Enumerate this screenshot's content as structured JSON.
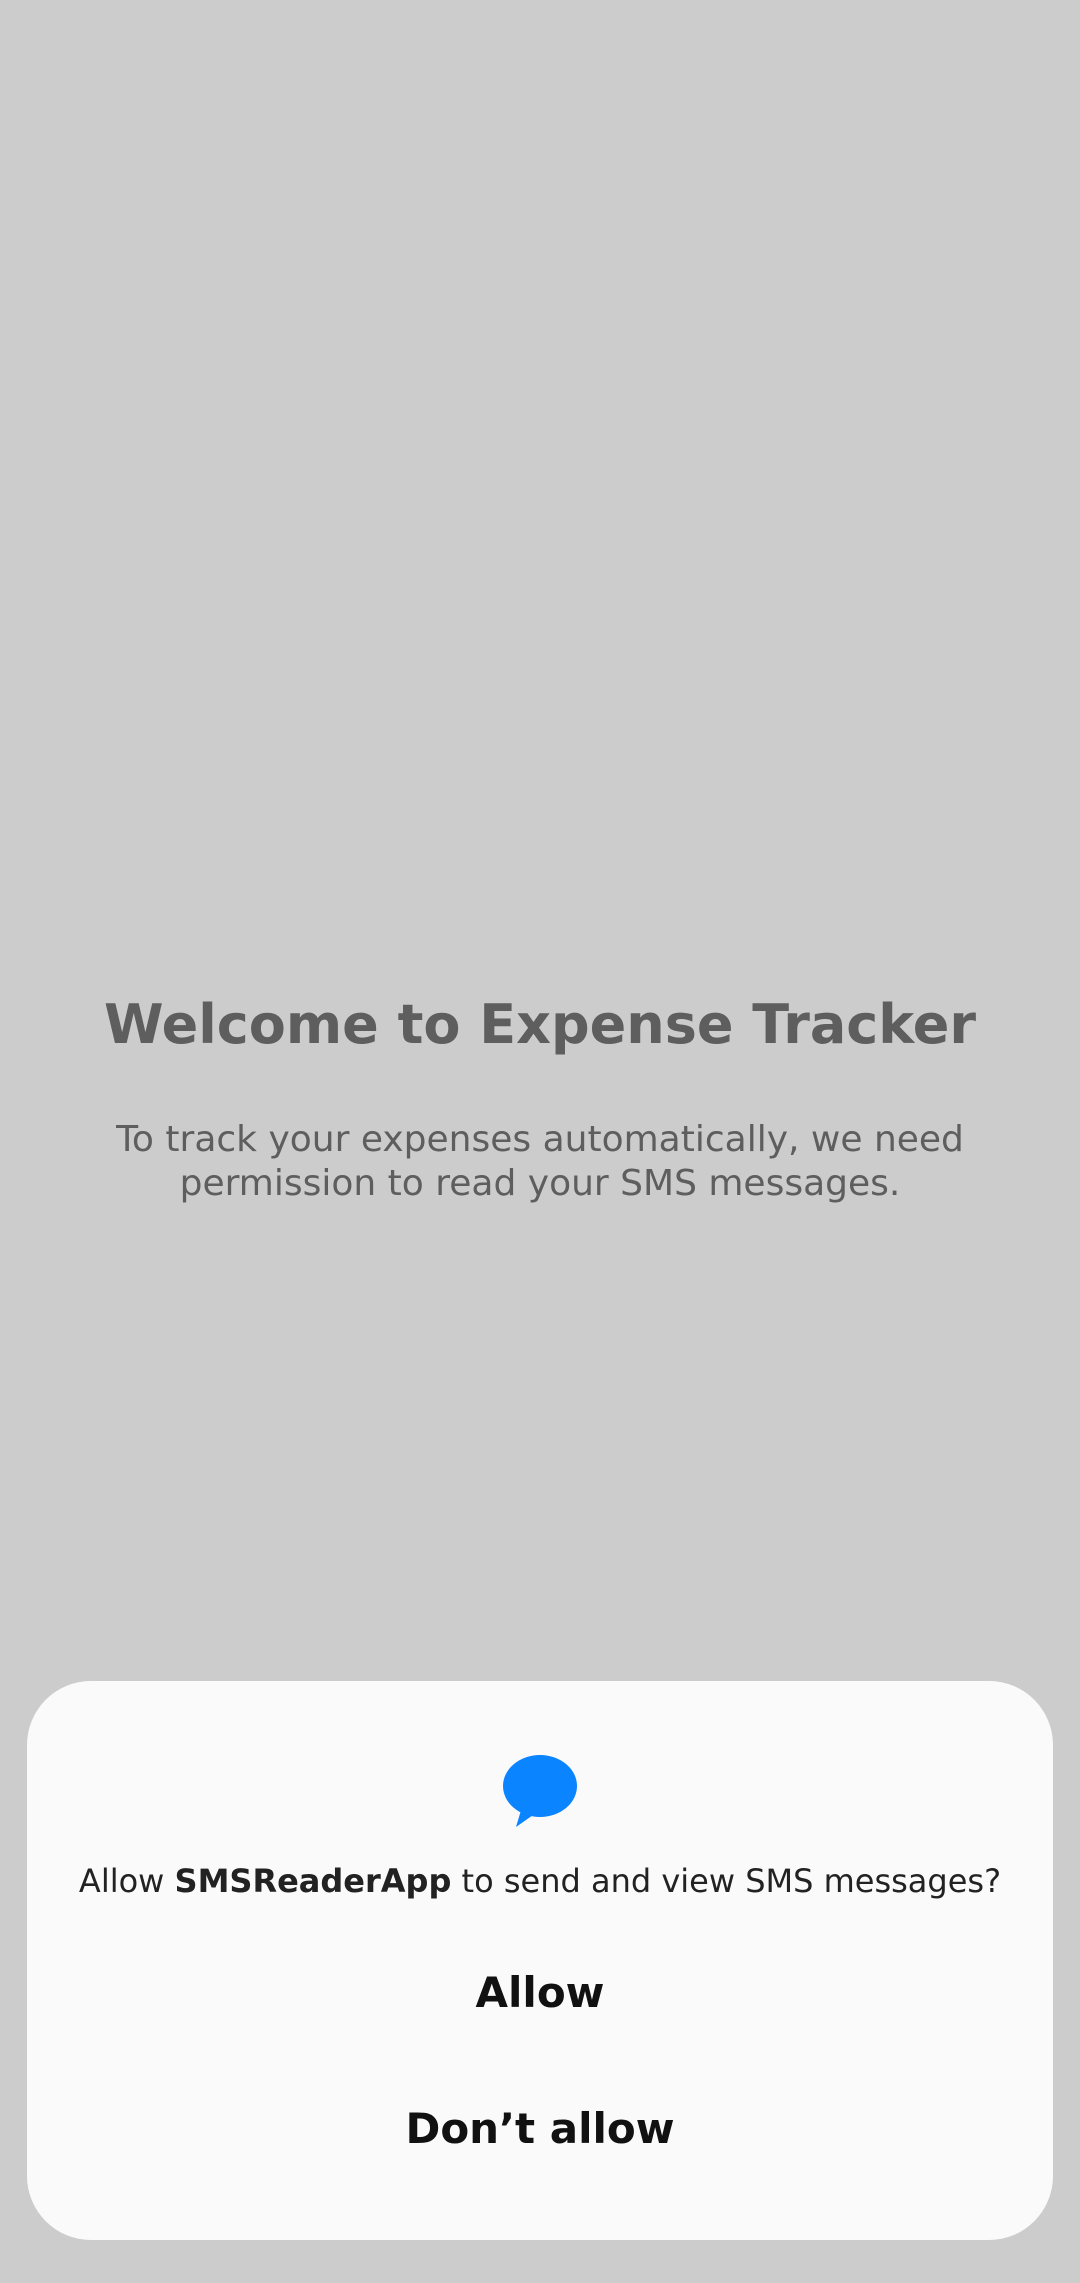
{
  "app": {
    "welcome_title": "Welcome to Expense Tracker",
    "welcome_body": "To track your expenses automatically, we need permission to read your SMS messages."
  },
  "permission_dialog": {
    "icon": "sms-bubble-icon",
    "message_prefix": "Allow ",
    "app_name": "SMSReaderApp",
    "message_suffix": " to send and view SMS messages?",
    "allow_label": "Allow",
    "deny_label": "Don’t allow"
  },
  "colors": {
    "background_dim": "#cccccc",
    "dialog_background": "#fafafa",
    "icon_accent": "#0a84ff",
    "muted_text": "#5e5e5e"
  }
}
